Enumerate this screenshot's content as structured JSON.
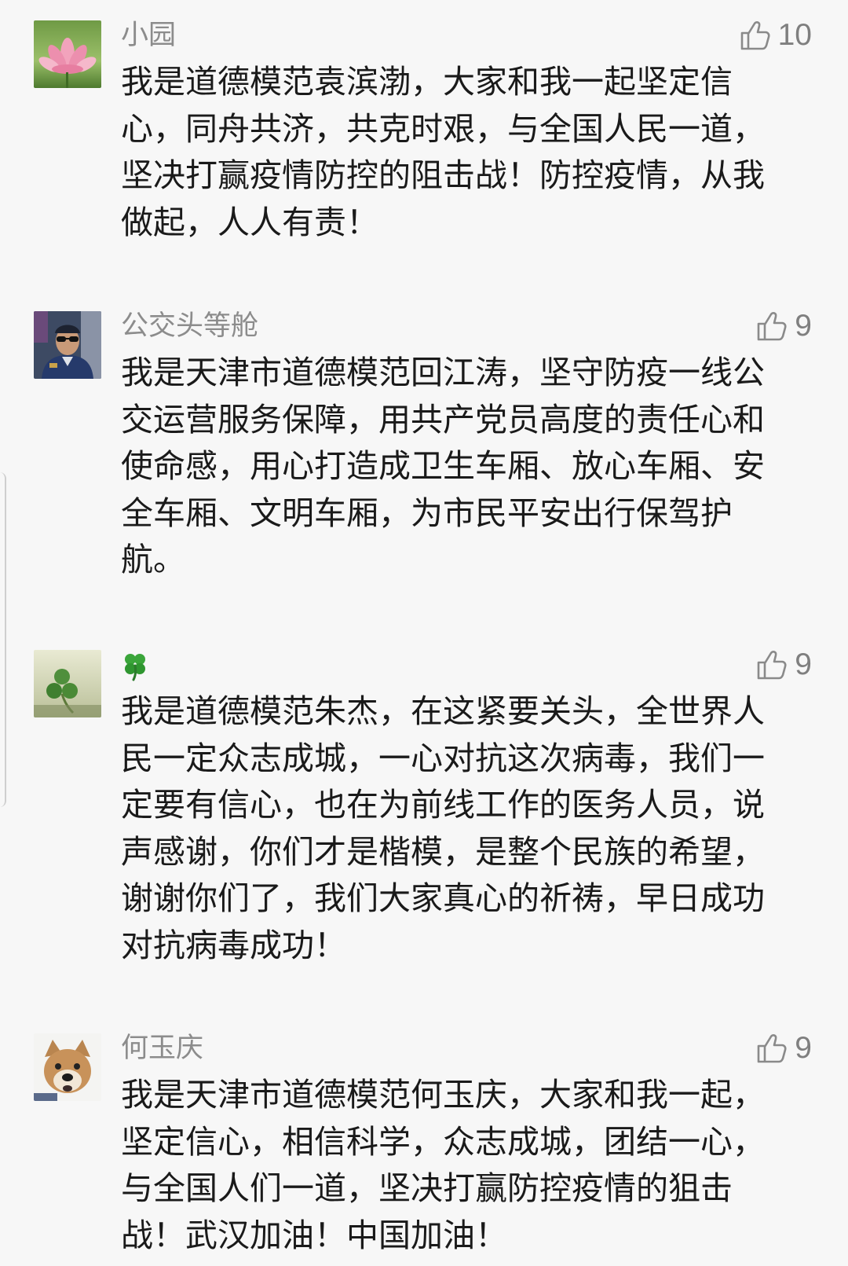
{
  "colors": {
    "background": "#f7f7f7",
    "name": "#8c8c8c",
    "text": "#1a1a1a",
    "like": "#7f7f7f",
    "clover_green": "#3aa53a"
  },
  "comments": [
    {
      "name": "小园",
      "avatar": "lotus-avatar",
      "like_icon": "thumbs-up-icon",
      "likes": "10",
      "lines": [
        "我是道德模范袁滨渤，大家和我一起坚定信",
        "心，同舟共济，共克时艰，与全国人民一道，",
        "坚决打赢疫情防控的阻击战！防控疫情，从我",
        "做起，人人有责！"
      ]
    },
    {
      "name": "公交头等舱",
      "avatar": "uniformed-man-avatar",
      "like_icon": "thumbs-up-icon",
      "likes": "9",
      "lines": [
        "我是天津市道德模范回江涛，坚守防疫一线公",
        "交运营服务保障，用共产党员高度的责任心和",
        "使命感，用心打造成卫生车厢、放心车厢、安",
        "全车厢、文明车厢，为市民平安出行保驾护",
        "航。"
      ]
    },
    {
      "name_icon": "four-leaf-clover-icon",
      "avatar": "clover-avatar",
      "like_icon": "thumbs-up-icon",
      "likes": "9",
      "lines": [
        "我是道德模范朱杰，在这紧要关头，全世界人",
        "民一定众志成城，一心对抗这次病毒，我们一",
        "定要有信心，也在为前线工作的医务人员，说",
        "声感谢，你们才是楷模，是整个民族的希望，",
        "谢谢你们了，我们大家真心的祈祷，早日成功",
        "对抗病毒成功！"
      ]
    },
    {
      "name": "何玉庆",
      "avatar": "dog-avatar",
      "like_icon": "thumbs-up-icon",
      "likes": "9",
      "lines": [
        "我是天津市道德模范何玉庆，大家和我一起，",
        "坚定信心，相信科学，众志成城，团结一心，",
        "与全国人们一道，坚决打赢防控疫情的狙击",
        "战！武汉加油！中国加油！"
      ]
    }
  ]
}
